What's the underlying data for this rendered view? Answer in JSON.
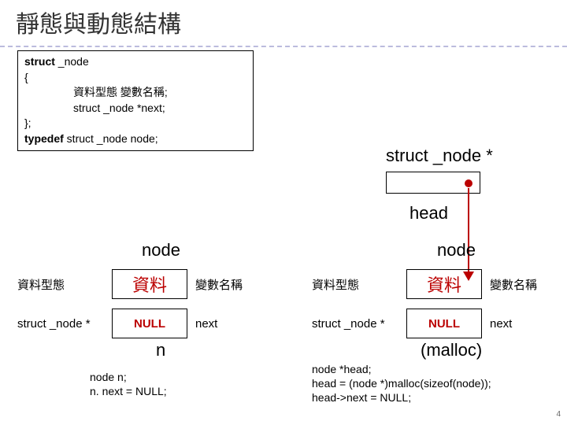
{
  "title": "靜態與動態結構",
  "code": {
    "l1a": "struct",
    "l1b": " _node",
    "l2": "{",
    "l3": "資料型態 變數名稱;",
    "l4": "struct _node *next;",
    "l5": "};",
    "l6a": "typedef",
    "l6b": " struct _node node;"
  },
  "ptr_type": "struct _node *",
  "head_label": "head",
  "node_label": "node",
  "left": {
    "row1_left": "資料型態",
    "row1_cell": "資料",
    "row1_right": "變數名稱",
    "row2_left": "struct _node *",
    "row2_cell": "NULL",
    "row2_right": "next",
    "caption": "n",
    "code_l1": "node n;",
    "code_l2": "n. next = NULL;"
  },
  "right": {
    "row1_left": "資料型態",
    "row1_cell": "資料",
    "row1_right": "變數名稱",
    "row2_left": "struct _node *",
    "row2_cell": "NULL",
    "row2_right": "next",
    "caption": "(malloc)",
    "code_l1": "node *head;",
    "code_l2": "head = (node *)malloc(sizeof(node));",
    "code_l3": "head->next = NULL;"
  },
  "page": "4"
}
